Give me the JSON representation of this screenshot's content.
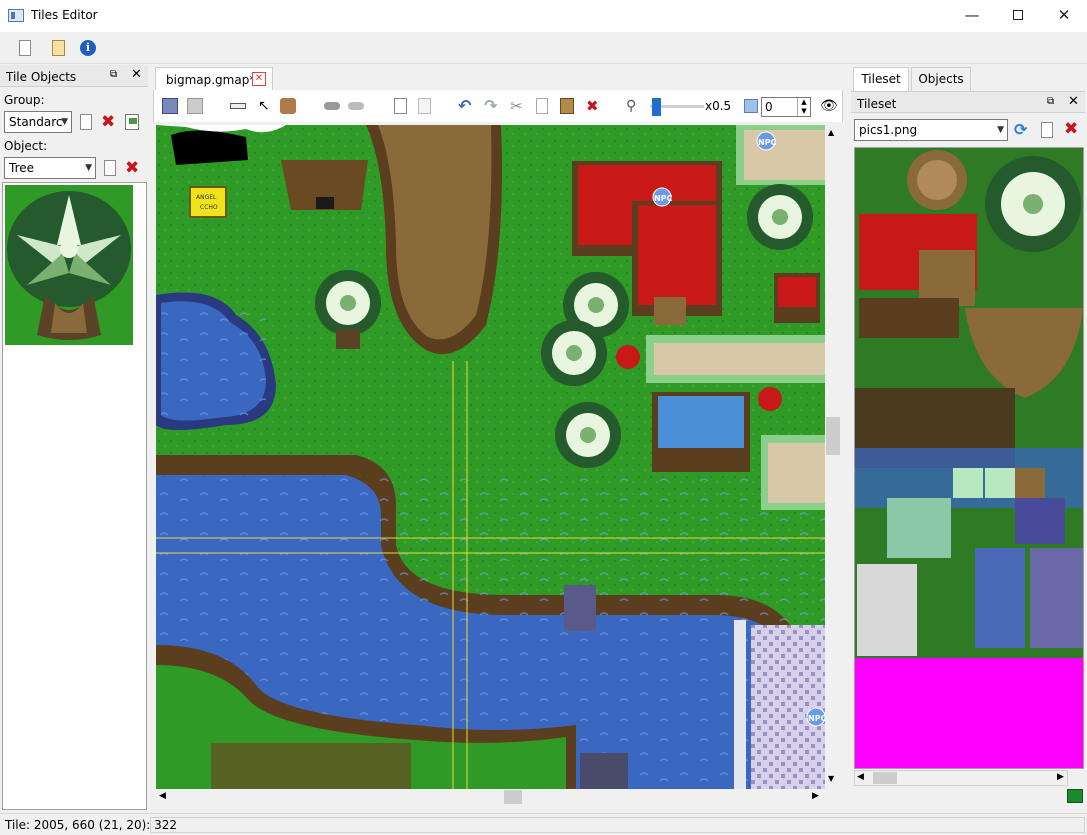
{
  "window": {
    "title": "Tiles Editor",
    "minimize_icon": "minimize-icon",
    "maximize_icon": "maximize-icon",
    "close_icon": "close-icon"
  },
  "main_toolbar": {
    "icons": [
      "new-file-icon",
      "open-file-icon",
      "info-icon"
    ]
  },
  "tile_objects_panel": {
    "title": "Tile Objects",
    "group_label": "Group:",
    "group_value": "Standarc",
    "object_label": "Object:",
    "object_value": "Tree"
  },
  "editor": {
    "tab_label": "bigmap.gmap*",
    "zoom_label": "x0.5",
    "zoom_fraction": 0.05,
    "layer_value": "0",
    "map_labels": {
      "npc": "NPC",
      "sign_line1": "ANGEL",
      "sign_line2": "CCHO"
    }
  },
  "right_panel": {
    "tabs": [
      "Tileset",
      "Objects"
    ],
    "active_tab": "Tileset",
    "tileset_title": "Tileset",
    "tileset_file": "pics1.png"
  },
  "status": {
    "text": "Tile: 2005, 660 (21, 20): 322"
  },
  "colors": {
    "grass": "#2f9a26",
    "water": "#3a67c0",
    "dirt": "#8a6a3a",
    "roof_red": "#c81818",
    "magenta": "#ff00ff",
    "accent_blue": "#1f6fcf"
  }
}
